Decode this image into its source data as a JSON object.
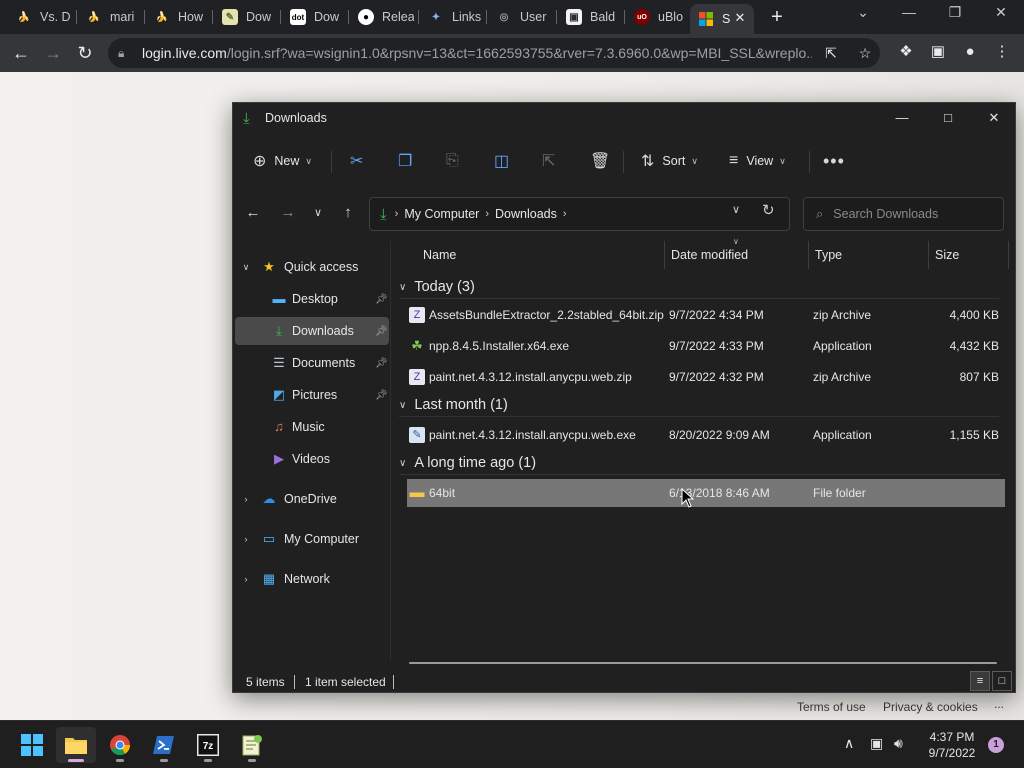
{
  "browser": {
    "tabs": [
      {
        "label": "Vs. D",
        "icon": "banana-icon"
      },
      {
        "label": "mari",
        "icon": "banana-icon"
      },
      {
        "label": "How",
        "icon": "banana-icon"
      },
      {
        "label": "Dow",
        "icon": "notepad-icon"
      },
      {
        "label": "Dow",
        "icon": "dotnet-icon"
      },
      {
        "label": "Relea",
        "icon": "github-icon"
      },
      {
        "label": "Links",
        "icon": "link-icon"
      },
      {
        "label": "User",
        "icon": "globe-icon"
      },
      {
        "label": "Bald",
        "icon": "game-icon"
      },
      {
        "label": "uBlo",
        "icon": "ublock-icon"
      },
      {
        "label": "S",
        "icon": "microsoft-icon"
      }
    ],
    "url_host": "login.live.com",
    "url_path": "/login.srf?wa=wsignin1.0&rpsnv=13&ct=1662593755&rver=7.3.6960.0&wp=MBI_SSL&wreplo..."
  },
  "page": {
    "terms": "Terms of use",
    "privacy": "Privacy & cookies",
    "more": "..."
  },
  "explorer": {
    "title": "Downloads",
    "commands": {
      "new": "New",
      "sort": "Sort",
      "view": "View"
    },
    "address": {
      "crumbs": [
        "My Computer",
        "Downloads"
      ]
    },
    "search": {
      "placeholder": "Search Downloads"
    },
    "nav": {
      "quick_access": "Quick access",
      "items": [
        {
          "label": "Desktop"
        },
        {
          "label": "Downloads"
        },
        {
          "label": "Documents"
        },
        {
          "label": "Pictures"
        },
        {
          "label": "Music"
        },
        {
          "label": "Videos"
        }
      ],
      "onedrive": "OneDrive",
      "mycomputer": "My Computer",
      "network": "Network"
    },
    "columns": {
      "name": "Name",
      "date": "Date modified",
      "type": "Type",
      "size": "Size"
    },
    "groups": [
      {
        "label": "Today (3)"
      },
      {
        "label": "Last month (1)"
      },
      {
        "label": "A long time ago (1)"
      }
    ],
    "files": [
      {
        "name": "AssetsBundleExtractor_2.2stabled_64bit.zip",
        "date": "9/7/2022 4:34 PM",
        "type": "zip Archive",
        "size": "4,400 KB"
      },
      {
        "name": "npp.8.4.5.Installer.x64.exe",
        "date": "9/7/2022 4:33 PM",
        "type": "Application",
        "size": "4,432 KB"
      },
      {
        "name": "paint.net.4.3.12.install.anycpu.web.zip",
        "date": "9/7/2022 4:32 PM",
        "type": "zip Archive",
        "size": "807 KB"
      },
      {
        "name": "paint.net.4.3.12.install.anycpu.web.exe",
        "date": "8/20/2022 9:09 AM",
        "type": "Application",
        "size": "1,155 KB"
      },
      {
        "name": "64bit",
        "date": "6/13/2018 8:46 AM",
        "type": "File folder",
        "size": ""
      }
    ],
    "status": {
      "count": "5 items",
      "selected": "1 item selected"
    }
  },
  "taskbar": {
    "time": "4:37 PM",
    "date": "9/7/2022",
    "notifications": "1"
  }
}
